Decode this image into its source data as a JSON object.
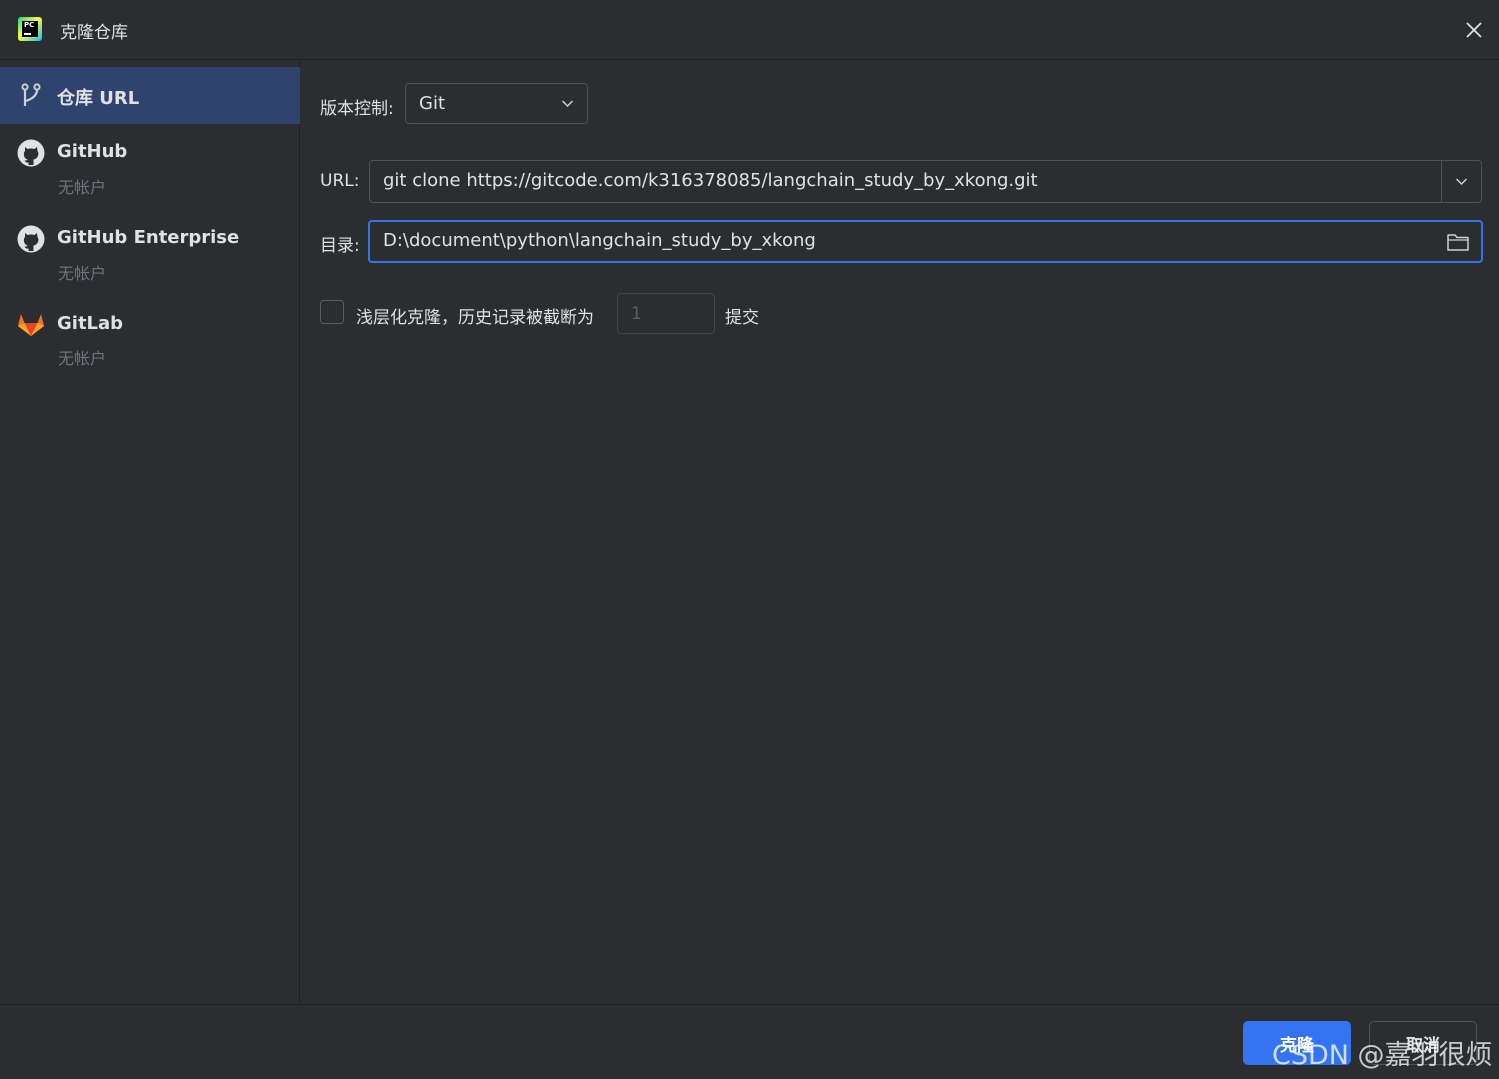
{
  "window": {
    "title": "克隆仓库",
    "app_icon_text": "PC"
  },
  "sidebar": {
    "items": [
      {
        "label": "仓库 URL",
        "sub": "",
        "icon": "vcs-branch-icon",
        "selected": true
      },
      {
        "label": "GitHub",
        "sub": "无帐户",
        "icon": "github-icon",
        "selected": false
      },
      {
        "label": "GitHub Enterprise",
        "sub": "无帐户",
        "icon": "github-icon",
        "selected": false
      },
      {
        "label": "GitLab",
        "sub": "无帐户",
        "icon": "gitlab-icon",
        "selected": false
      }
    ]
  },
  "form": {
    "vcs_label": "版本控制:",
    "vcs_value": "Git",
    "url_label": "URL:",
    "url_value": "git clone https://gitcode.com/k316378085/langchain_study_by_xkong.git",
    "dir_label": "目录:",
    "dir_value": "D:\\document\\python\\langchain_study_by_xkong",
    "shallow_label": "浅层化克隆，历史记录被截断为",
    "shallow_value": "1",
    "shallow_suffix": "提交"
  },
  "footer": {
    "clone_label": "克隆",
    "cancel_label": "取消"
  },
  "watermark": "CSDN @嘉羽很烦",
  "colors": {
    "background": "#2b2d30",
    "selection": "#2e436e",
    "accent": "#3574f0",
    "text": "#dfe1e5",
    "muted": "#6f737a"
  }
}
